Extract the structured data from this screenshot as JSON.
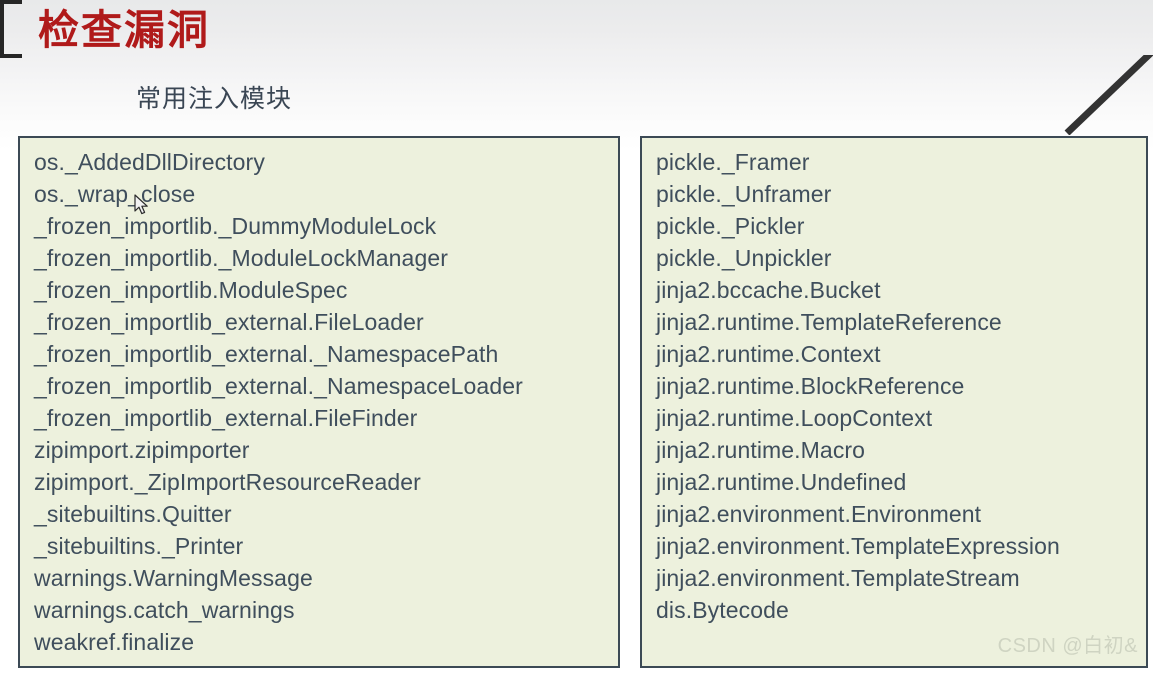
{
  "slide": {
    "title": "检查漏洞",
    "subtitle": "常用注入模块",
    "title_color": "#b01a1a",
    "subtitle_color": "#3a4654",
    "panel_background": "#edf1dd",
    "panel_border_color": "#3c4a55",
    "text_color": "#3f4e5c",
    "background_color": "#ffffff"
  },
  "watermark": {
    "text": "CSDN @白初&",
    "color": "#cfd4c2"
  },
  "left_panel": {
    "name": "common-injection-modules-left",
    "items": [
      "os._AddedDllDirectory",
      "os._wrap_close",
      "_frozen_importlib._DummyModuleLock",
      "_frozen_importlib._ModuleLockManager",
      "_frozen_importlib.ModuleSpec",
      "_frozen_importlib_external.FileLoader",
      "_frozen_importlib_external._NamespacePath",
      "_frozen_importlib_external._NamespaceLoader",
      "_frozen_importlib_external.FileFinder",
      "zipimport.zipimporter",
      "zipimport._ZipImportResourceReader",
      "_sitebuiltins.Quitter",
      "_sitebuiltins._Printer",
      "warnings.WarningMessage",
      "warnings.catch_warnings",
      "weakref.finalize"
    ]
  },
  "right_panel": {
    "name": "common-injection-modules-right",
    "items": [
      "pickle._Framer",
      "pickle._Unframer",
      "pickle._Pickler",
      "pickle._Unpickler",
      "jinja2.bccache.Bucket",
      "jinja2.runtime.TemplateReference",
      "jinja2.runtime.Context",
      "jinja2.runtime.BlockReference",
      "jinja2.runtime.LoopContext",
      "jinja2.runtime.Macro",
      "jinja2.runtime.Undefined",
      "jinja2.environment.Environment",
      "jinja2.environment.TemplateExpression",
      "jinja2.environment.TemplateStream",
      "dis.Bytecode"
    ]
  }
}
